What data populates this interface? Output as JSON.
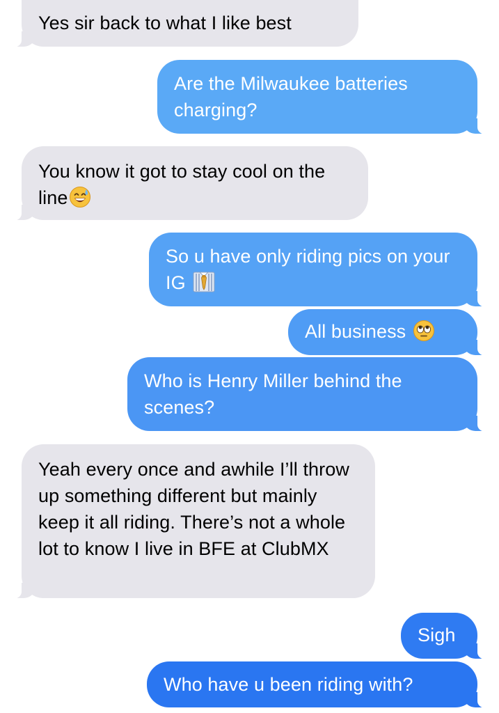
{
  "messages": [
    {
      "direction": "received",
      "text": "Yes sir back to what I like best",
      "color": "#e6e5eb"
    },
    {
      "direction": "sent",
      "text": "Are the Milwaukee batteries charging?",
      "color": "#5aa9f6"
    },
    {
      "direction": "received",
      "text": "You know it got to stay cool on the line",
      "emoji": "grinning-sweat-icon",
      "color": "#e6e5eb"
    },
    {
      "direction": "sent",
      "text": "So u have only riding pics on your IG",
      "emoji": "necktie-shirt-icon",
      "color": "#55a2f5"
    },
    {
      "direction": "sent",
      "text": "All business",
      "emoji": "eye-roll-icon",
      "color": "#4f9cf5"
    },
    {
      "direction": "sent",
      "text": "Who is Henry Miller behind the scenes?",
      "color": "#4b96f4"
    },
    {
      "direction": "received",
      "text": "Yeah every once and awhile I’ll throw up something different but mainly keep it all riding. There’s not a whole lot to know I live in BFE at ClubMX",
      "color": "#e6e5eb"
    },
    {
      "direction": "sent",
      "text": "Sigh",
      "color": "#2f7bf2"
    },
    {
      "direction": "sent",
      "text": "Who have u been riding with?",
      "color": "#2a76f1"
    }
  ]
}
